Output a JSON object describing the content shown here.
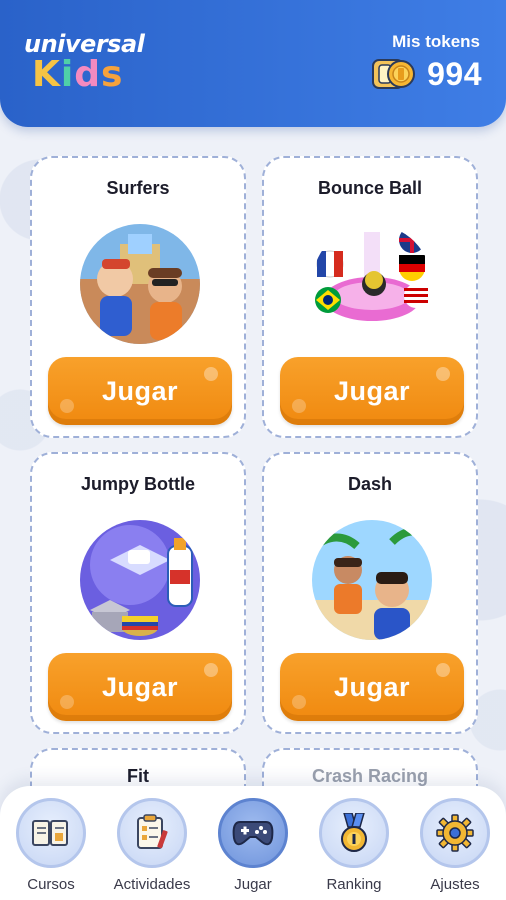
{
  "header": {
    "logo_line1": "universal",
    "logo_line2": "KIDS",
    "tokens_label": "Mis tokens",
    "tokens_value": "994"
  },
  "games": [
    {
      "title": "Surfers",
      "button": "Jugar"
    },
    {
      "title": "Bounce Ball",
      "button": "Jugar"
    },
    {
      "title": "Jumpy Bottle",
      "button": "Jugar"
    },
    {
      "title": "Dash",
      "button": "Jugar"
    },
    {
      "title": "Fit"
    },
    {
      "title": "Crash Racing"
    }
  ],
  "nav": [
    {
      "label": "Cursos",
      "icon": "book-icon"
    },
    {
      "label": "Actividades",
      "icon": "checklist-icon"
    },
    {
      "label": "Jugar",
      "icon": "gamepad-icon",
      "active": true
    },
    {
      "label": "Ranking",
      "icon": "medal-icon"
    },
    {
      "label": "Ajustes",
      "icon": "gear-icon"
    }
  ],
  "colors": {
    "header": "#3a74dc",
    "play_button": "#f39218",
    "card_border": "#9fb0d8"
  }
}
